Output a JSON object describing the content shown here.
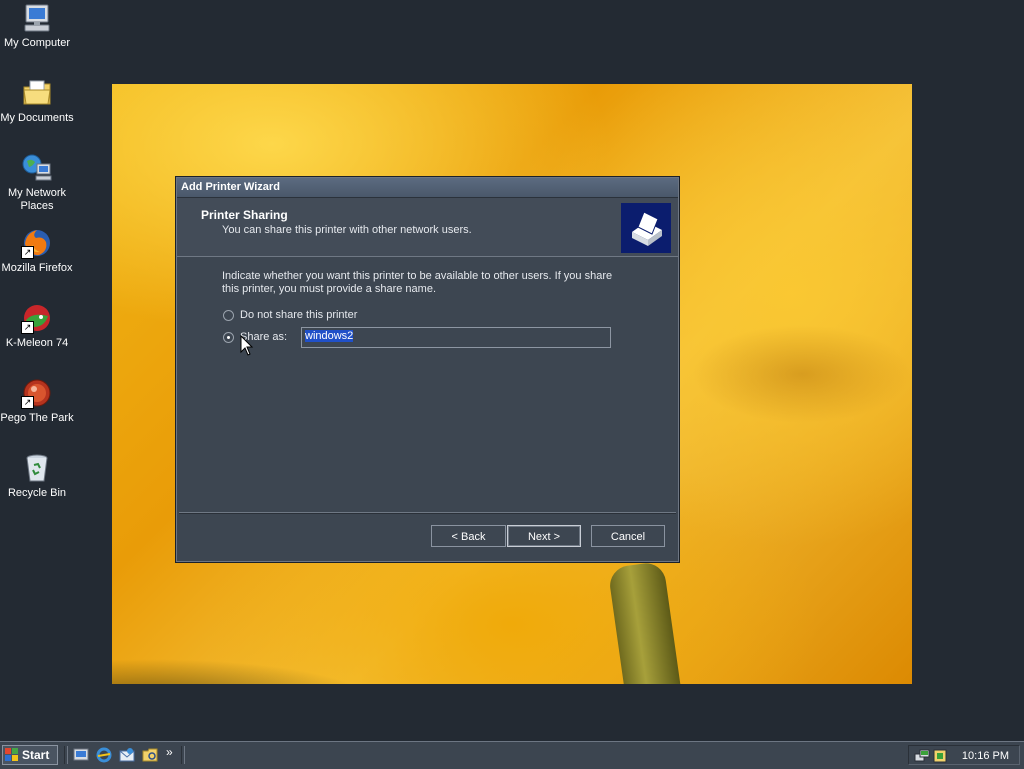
{
  "desktop": {
    "icons": [
      {
        "label": "My Computer"
      },
      {
        "label": "My Documents"
      },
      {
        "label_line1": "My Network",
        "label_line2": "Places"
      },
      {
        "label": "Mozilla Firefox"
      },
      {
        "label": "K-Meleon 74"
      },
      {
        "label": "Pego The Park"
      },
      {
        "label": "Recycle Bin"
      }
    ]
  },
  "dialog": {
    "title": "Add Printer Wizard",
    "header_title": "Printer Sharing",
    "header_subtitle": "You can share this printer with other network users.",
    "description": "Indicate whether you want this printer to be available to other users. If you share this printer, you must provide a share name.",
    "option_no_share": "Do not share this printer",
    "option_share_as": "Share as:",
    "share_name_value": "windows2",
    "selected_option": "share_as",
    "back_label": "< Back",
    "next_label": "Next >",
    "cancel_label": "Cancel"
  },
  "taskbar": {
    "start_label": "Start",
    "overflow": "»",
    "clock": "10:16 PM"
  },
  "colors": {
    "dialog_bg": "#3d4651",
    "header_icon_bg": "#0b1d6e",
    "desktop_bg": "#232a33",
    "selection": "#2050c8"
  }
}
